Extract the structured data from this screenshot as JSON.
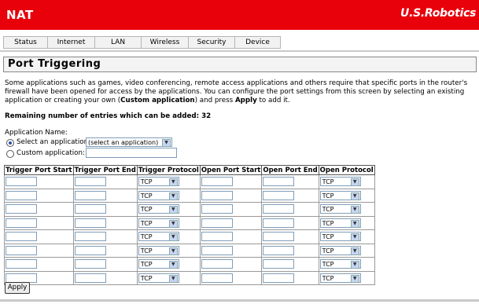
{
  "header": {
    "title": "NAT",
    "logo": "U.S.Robotics",
    "bg_color": "#e8000b"
  },
  "tabs": [
    {
      "label": "Status"
    },
    {
      "label": "Internet"
    },
    {
      "label": "LAN"
    },
    {
      "label": "Wireless"
    },
    {
      "label": "Security"
    },
    {
      "label": "Device"
    }
  ],
  "section": {
    "title": "Port Triggering"
  },
  "description_parts": {
    "p1": "Some applications such as games, video conferencing, remote access applications and others require that specific ports in the router's firewall have been opened for access by the applications. You can configure the port settings from this screen by selecting an existing application or creating your own (",
    "custom": "Custom application",
    "p2": ") and press ",
    "apply": "Apply",
    "p3": " to add it."
  },
  "remaining": "Remaining number of entries which can be added: 32",
  "app": {
    "name_label": "Application Name:",
    "select_label": "Select an application:",
    "select_value": "(select an application)",
    "custom_label": "Custom application:",
    "custom_value": ""
  },
  "table": {
    "headers": [
      "Trigger Port Start",
      "Trigger Port End",
      "Trigger Protocol",
      "Open Port Start",
      "Open Port End",
      "Open Protocol"
    ],
    "rows": [
      {
        "trigger_protocol": "TCP",
        "open_protocol": "TCP"
      },
      {
        "trigger_protocol": "TCP",
        "open_protocol": "TCP"
      },
      {
        "trigger_protocol": "TCP",
        "open_protocol": "TCP"
      },
      {
        "trigger_protocol": "TCP",
        "open_protocol": "TCP"
      },
      {
        "trigger_protocol": "TCP",
        "open_protocol": "TCP"
      },
      {
        "trigger_protocol": "TCP",
        "open_protocol": "TCP"
      },
      {
        "trigger_protocol": "TCP",
        "open_protocol": "TCP"
      },
      {
        "trigger_protocol": "TCP",
        "open_protocol": "TCP"
      }
    ]
  },
  "apply_label": "Apply"
}
